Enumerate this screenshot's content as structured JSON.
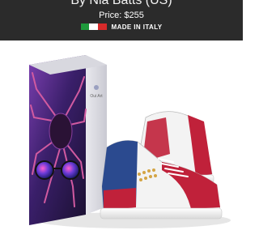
{
  "header": {
    "byline": "By Nia Batts (US)",
    "price": "Price: $255",
    "made_in": "MADE IN ITALY",
    "flag_colors": [
      "#1f9a3c",
      "#ffffff",
      "#d72a2a"
    ]
  },
  "product": {
    "box_label": "Oui Art",
    "colors": {
      "box_art": "#5a2a8a",
      "shoe_red": "#c0213a",
      "shoe_blue": "#2b4a8f",
      "shoe_white": "#f3f3f3",
      "stud_gold": "#d4a545"
    }
  }
}
